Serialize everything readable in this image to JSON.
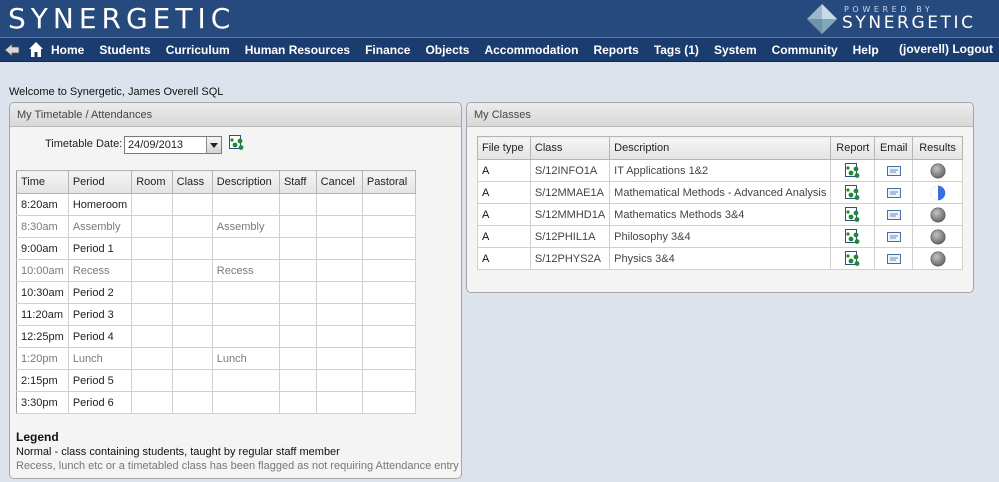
{
  "header": {
    "logo": "SYNERGETIC",
    "powered_by": "POWERED BY",
    "brand": "SYNERGETIC"
  },
  "nav": {
    "items": [
      "Home",
      "Students",
      "Curriculum",
      "Human Resources",
      "Finance",
      "Objects",
      "Accommodation",
      "Reports",
      "Tags (1)",
      "System",
      "Community",
      "Help"
    ],
    "user": "(joverell) Logout"
  },
  "welcome": "Welcome to Synergetic, James Overell SQL",
  "timetable": {
    "title": "My Timetable / Attendances",
    "date_label": "Timetable Date:",
    "date_value": "24/09/2013",
    "columns": [
      "Time",
      "Period",
      "Room",
      "Class",
      "Description",
      "Staff",
      "Cancel",
      "Pastoral"
    ],
    "rows": [
      {
        "time": "8:20am",
        "period": "Homeroom",
        "room": "",
        "class": "",
        "description": "",
        "flagged": false
      },
      {
        "time": "8:30am",
        "period": "Assembly",
        "room": "",
        "class": "",
        "description": "Assembly",
        "flagged": true
      },
      {
        "time": "9:00am",
        "period": "Period 1",
        "room": "",
        "class": "",
        "description": "",
        "flagged": false
      },
      {
        "time": "10:00am",
        "period": "Recess",
        "room": "",
        "class": "",
        "description": "Recess",
        "flagged": true
      },
      {
        "time": "10:30am",
        "period": "Period 2",
        "room": "",
        "class": "",
        "description": "",
        "flagged": false
      },
      {
        "time": "11:20am",
        "period": "Period 3",
        "room": "",
        "class": "",
        "description": "",
        "flagged": false
      },
      {
        "time": "12:25pm",
        "period": "Period 4",
        "room": "",
        "class": "",
        "description": "",
        "flagged": false
      },
      {
        "time": "1:20pm",
        "period": "Lunch",
        "room": "",
        "class": "",
        "description": "Lunch",
        "flagged": true
      },
      {
        "time": "2:15pm",
        "period": "Period 5",
        "room": "",
        "class": "",
        "description": "",
        "flagged": false
      },
      {
        "time": "3:30pm",
        "period": "Period 6",
        "room": "",
        "class": "",
        "description": "",
        "flagged": false
      }
    ],
    "legend_title": "Legend",
    "legend_normal": "Normal - class containing students, taught by regular staff member",
    "legend_flagged": "Recess, lunch etc or a timetabled class has been flagged as not requiring Attendance entry"
  },
  "classes": {
    "title": "My Classes",
    "columns": [
      "File type",
      "Class",
      "Description",
      "Report",
      "Email",
      "Results"
    ],
    "rows": [
      {
        "file_type": "A",
        "class": "S/12INFO1A",
        "description": "IT Applications 1&2",
        "result": "none"
      },
      {
        "file_type": "A",
        "class": "S/12MMAE1A",
        "description": "Mathematical Methods - Advanced Analysis",
        "result": "partial"
      },
      {
        "file_type": "A",
        "class": "S/12MMHD1A",
        "description": "Mathematics Methods 3&4",
        "result": "none"
      },
      {
        "file_type": "A",
        "class": "S/12PHIL1A",
        "description": "Philosophy 3&4",
        "result": "none"
      },
      {
        "file_type": "A",
        "class": "S/12PHYS2A",
        "description": "Physics 3&4",
        "result": "none"
      }
    ]
  },
  "colors": {
    "header_bg": "#274a7e",
    "nav_bg": "#1b3c6e",
    "page_bg": "#dde3ec",
    "flagged_text": "#7a7a7a",
    "result_blue": "#3a6fe0"
  },
  "icons": {
    "back": "back-arrow-icon",
    "home": "home-icon",
    "go": "report-icon",
    "report": "report-icon",
    "email": "email-icon",
    "result_none": "grey-circle-icon",
    "result_partial": "half-blue-circle-icon"
  }
}
